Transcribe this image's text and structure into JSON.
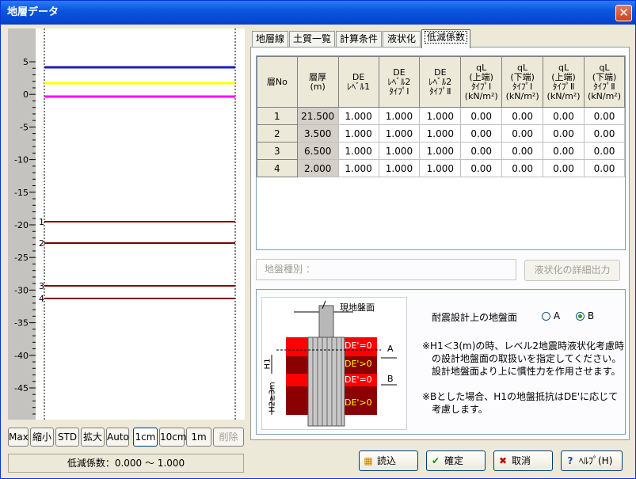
{
  "window": {
    "title": "地層データ",
    "close_glyph": "✕"
  },
  "ruler": {
    "ticks": [
      "5",
      "0",
      "-5",
      "-10",
      "-15",
      "-20",
      "-25",
      "-30",
      "-35",
      "-40",
      "-45"
    ]
  },
  "plot": {
    "layer_labels": [
      "1",
      "2",
      "3",
      "4"
    ],
    "line_colors": [
      "#1c1cc8",
      "#ffff00",
      "#ff00ff",
      "#800000"
    ]
  },
  "left_buttons": {
    "max": "Max",
    "shrink": "縮小",
    "std": "STD",
    "zoom": "拡大",
    "auto": "Auto",
    "cm1": "1cm",
    "cm10": "10cm",
    "m1": "1m",
    "delete": "削除"
  },
  "status": {
    "text": "低減係数：0.000 ～ 1.000"
  },
  "tabs": [
    "地層線",
    "土質一覧",
    "計算条件",
    "液状化",
    "低減係数"
  ],
  "table": {
    "headers": [
      "層No",
      "層厚\n(m)",
      "DE\nﾚﾍﾞﾙ1",
      "DE\nﾚﾍﾞﾙ2\nﾀｲﾌﾟⅠ",
      "DE\nﾚﾍﾞﾙ2\nﾀｲﾌﾟⅡ",
      "qL\n(上端)\nﾀｲﾌﾟⅠ\n(kN/m²)",
      "qL\n(下端)\nﾀｲﾌﾟⅠ\n(kN/m²)",
      "qL\n(上端)\nﾀｲﾌﾟⅡ\n(kN/m²)",
      "qL\n(下端)\nﾀｲﾌﾟⅡ\n(kN/m²)"
    ],
    "rows": [
      [
        "1",
        "21.500",
        "1.000",
        "1.000",
        "1.000",
        "0.00",
        "0.00",
        "0.00",
        "0.00"
      ],
      [
        "2",
        "3.500",
        "1.000",
        "1.000",
        "1.000",
        "0.00",
        "0.00",
        "0.00",
        "0.00"
      ],
      [
        "3",
        "6.500",
        "1.000",
        "1.000",
        "1.000",
        "0.00",
        "0.00",
        "0.00",
        "0.00"
      ],
      [
        "4",
        "2.000",
        "1.000",
        "1.000",
        "1.000",
        "0.00",
        "0.00",
        "0.00",
        "0.00"
      ]
    ]
  },
  "ground": {
    "label": "地盤種別 ：",
    "detail_button": "液状化の詳細出力"
  },
  "figure": {
    "ground_surface": "現地盤面",
    "label_a": "A",
    "label_b": "B",
    "de_zero_1": "DE'=0",
    "de_pos_1": "DE'>0",
    "de_zero_2": "DE'=0",
    "de_pos_2": "DE'>0",
    "h1": "H1",
    "h2": "H2≥3m"
  },
  "design": {
    "label": "耐震設計上の地盤面",
    "option_a": "A",
    "option_b": "B",
    "selected": "B"
  },
  "notes": {
    "note1_l1": "※H1＜3(m)の時、レベル2地震時液状化考慮時",
    "note1_l2": "の設計地盤面の取扱いを指定してください。",
    "note1_l3": "設計地盤面より上に慣性力を作用させます。",
    "note2_l1": "※Bとした場合、H1の地盤抵抗はDE'に応じて",
    "note2_l2": "考慮します。"
  },
  "bottom_buttons": {
    "load": "読込",
    "ok": "確定",
    "cancel": "取消",
    "help": "ﾍﾙﾌﾟ(H)"
  }
}
